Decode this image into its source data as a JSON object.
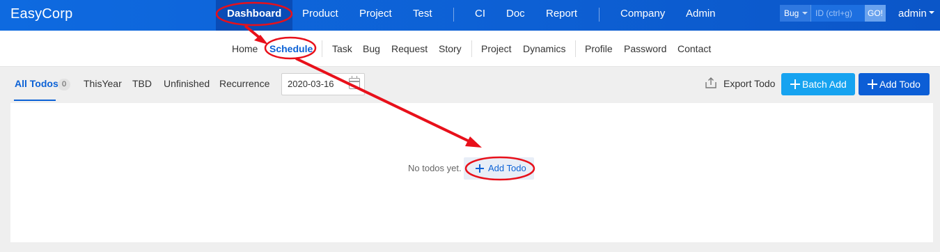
{
  "topbar": {
    "brand": "EasyCorp",
    "nav": [
      "Dashboard",
      "Product",
      "Project",
      "Test",
      "CI",
      "Doc",
      "Report",
      "Company",
      "Admin"
    ],
    "active": "Dashboard",
    "search_type": "Bug",
    "search_placeholder": "ID (ctrl+g)",
    "go_label": "GO!",
    "user": "admin"
  },
  "subnav": {
    "items": [
      "Home",
      "Schedule",
      "Task",
      "Bug",
      "Request",
      "Story",
      "Project",
      "Dynamics",
      "Profile",
      "Password",
      "Contact"
    ],
    "active": "Schedule"
  },
  "toolbar": {
    "filters": [
      "All Todos",
      "ThisYear",
      "TBD",
      "Unfinished",
      "Recurrence"
    ],
    "active_filter": "All Todos",
    "count": "0",
    "date": "2020-03-16",
    "export_label": "Export Todo",
    "batch_add_label": "Batch Add",
    "add_label": "Add Todo"
  },
  "empty": {
    "text": "No todos yet.",
    "add_label": "Add Todo"
  },
  "colors": {
    "primary": "#0c5ed6",
    "secondary_button": "#16a3f0",
    "annotation": "#e8101a"
  },
  "icons": [
    "caret-down-icon",
    "calendar-icon",
    "export-icon",
    "plus-icon"
  ]
}
